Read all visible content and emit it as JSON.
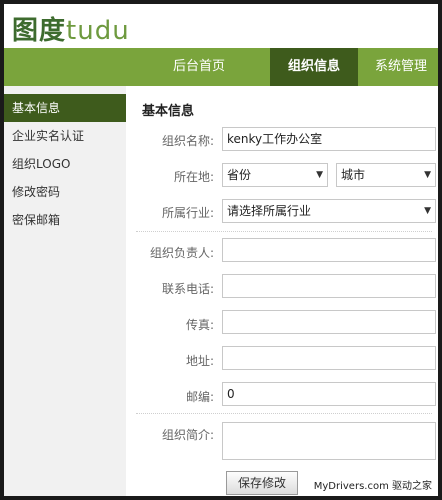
{
  "logo": {
    "cn": "图度",
    "en": "tudu"
  },
  "nav": {
    "home": "后台首页",
    "org": "组织信息",
    "sys": "系统管理"
  },
  "sidebar": {
    "items": [
      {
        "label": "基本信息"
      },
      {
        "label": "企业实名认证"
      },
      {
        "label": "组织LOGO"
      },
      {
        "label": "修改密码"
      },
      {
        "label": "密保邮箱"
      }
    ]
  },
  "form": {
    "title": "基本信息",
    "org_name": {
      "label": "组织名称:",
      "value": "kenky工作办公室"
    },
    "location": {
      "label": "所在地:",
      "province": "省份",
      "city": "城市"
    },
    "industry": {
      "label": "所属行业:",
      "value": "请选择所属行业"
    },
    "manager": {
      "label": "组织负责人:",
      "value": ""
    },
    "phone": {
      "label": "联系电话:",
      "value": ""
    },
    "fax": {
      "label": "传真:",
      "value": ""
    },
    "address": {
      "label": "地址:",
      "value": ""
    },
    "zipcode": {
      "label": "邮编:",
      "value": "0"
    },
    "intro": {
      "label": "组织简介:",
      "value": ""
    },
    "save": "保存修改"
  },
  "watermark": "MyDrivers.com 驱动之家"
}
